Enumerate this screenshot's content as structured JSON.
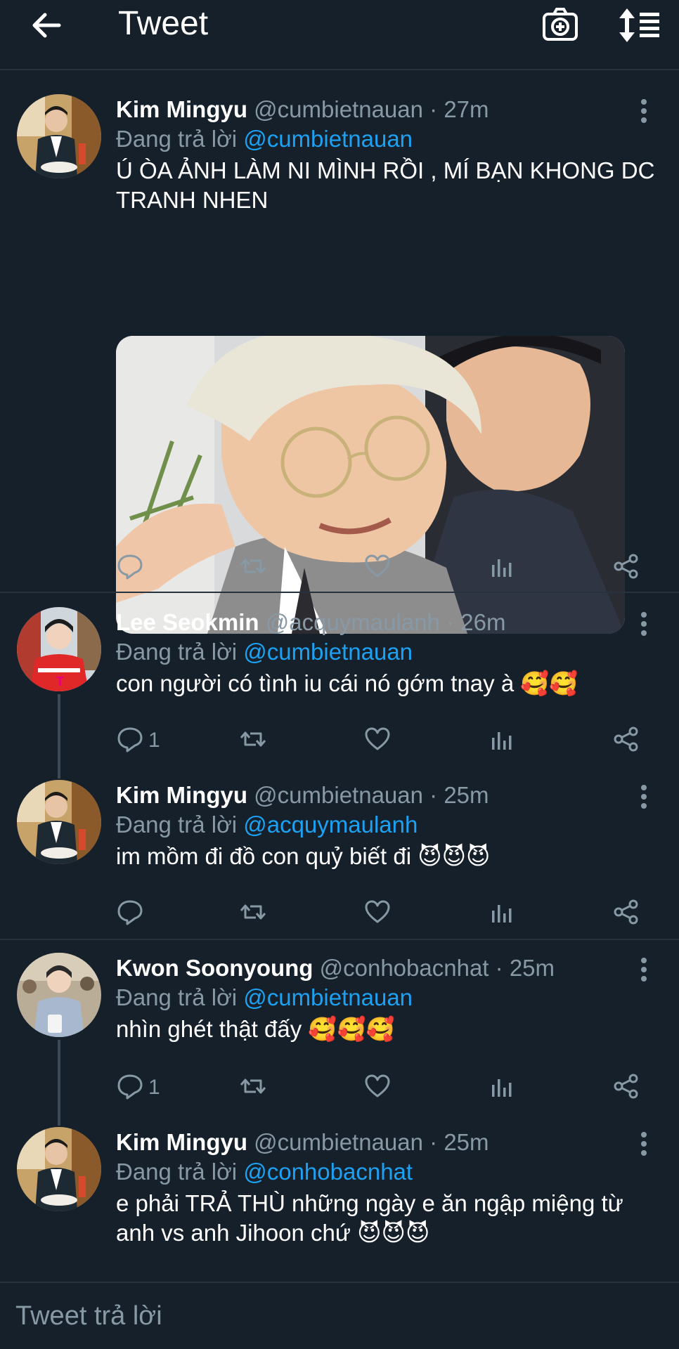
{
  "header": {
    "title": "Tweet"
  },
  "tweets": [
    {
      "name": "Kim Mingyu",
      "handle": "@cumbietnauan",
      "time": "· 27m",
      "reply_prefix": "Đang trả lời",
      "reply_to": "@cumbietnauan",
      "text": "Ú ÒA ẢNH LÀM NI MÌNH RỒI , MÍ BẠN KHONG DC TRANH NHEN",
      "reply_count": ""
    },
    {
      "name": "Lee Seokmin",
      "handle": "@acquymaulanh",
      "time": "· 26m",
      "reply_prefix": "Đang trả lời",
      "reply_to": "@cumbietnauan",
      "text": "con người có tình iu cái nó gớm tnay à 🥰🥰",
      "reply_count": "1"
    },
    {
      "name": "Kim Mingyu",
      "handle": "@cumbietnauan",
      "time": "· 25m",
      "reply_prefix": "Đang trả lời",
      "reply_to": "@acquymaulanh",
      "text": "im mồm đi đồ con quỷ biết đi 😈😈😈",
      "reply_count": ""
    },
    {
      "name": "Kwon Soonyoung",
      "handle": "@conhobacnhat",
      "time": "· 25m",
      "reply_prefix": "Đang trả lời",
      "reply_to": "@cumbietnauan",
      "text": "nhìn ghét thật đấy 🥰🥰🥰",
      "reply_count": "1"
    },
    {
      "name": "Kim Mingyu",
      "handle": "@cumbietnauan",
      "time": "· 25m",
      "reply_prefix": "Đang trả lời",
      "reply_to": "@conhobacnhat",
      "text": "e phải TRẢ THÙ những ngày e ăn ngập miệng từ anh vs anh Jihoon chứ 😈😈😈",
      "reply_count": ""
    }
  ],
  "reply_bar": {
    "placeholder": "Tweet trả lời"
  },
  "colors": {
    "background": "#15202b",
    "accent": "#1da1f2",
    "muted": "#8899a6",
    "divider": "#26323e"
  },
  "icons": [
    "back-arrow-icon",
    "camera-plus-icon",
    "sort-icon",
    "more-vertical-icon",
    "reply-icon",
    "retweet-icon",
    "like-icon",
    "analytics-icon",
    "share-icon"
  ]
}
